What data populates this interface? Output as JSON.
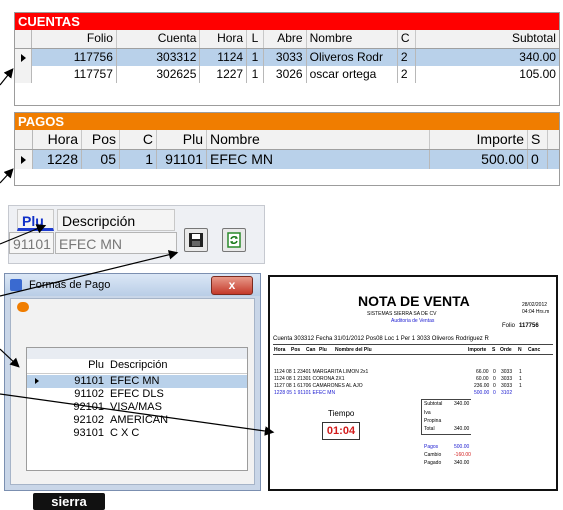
{
  "colors": {
    "cuentas_header": "#ff0000",
    "pagos_header": "#f07d00",
    "selection": "#b9d1ea",
    "timer_red": "#d21b1b"
  },
  "cuentas": {
    "title": "CUENTAS",
    "columns": [
      "Folio",
      "Cuenta",
      "Hora",
      "L",
      "Abre",
      "Nombre",
      "C",
      "Subtotal"
    ],
    "rows": [
      {
        "folio": "117756",
        "cuenta": "303312",
        "hora": "1124",
        "l": "1",
        "abre": "3033",
        "nombre": "Oliveros Rodr",
        "c": "2",
        "subtotal": "340.00"
      },
      {
        "folio": "117757",
        "cuenta": "302625",
        "hora": "1227",
        "l": "1",
        "abre": "3026",
        "nombre": "oscar ortega",
        "c": "2",
        "subtotal": "105.00"
      }
    ]
  },
  "pagos": {
    "title": "PAGOS",
    "columns": [
      "Hora",
      "Pos",
      "C",
      "Plu",
      "Nombre",
      "Importe",
      "S"
    ],
    "rows": [
      {
        "hora": "1228",
        "pos": "05",
        "c": "1",
        "plu": "91101",
        "nombre": "EFEC MN",
        "importe": "500.00",
        "s": "0"
      }
    ]
  },
  "producto": {
    "plu_label": "Plu",
    "desc_label": "Descripción",
    "plu_value": "91101",
    "desc_value": "EFEC MN",
    "save_icon": "floppy-disk-icon",
    "refresh_icon": "refresh-icon"
  },
  "formas_pago": {
    "title": "Formas de Pago",
    "close": "x",
    "columns": [
      "Plu",
      "Descripción"
    ],
    "rows": [
      {
        "plu": "91101",
        "desc": "EFEC MN"
      },
      {
        "plu": "91102",
        "desc": "EFEC DLS"
      },
      {
        "plu": "92101",
        "desc": "VISA/MAS"
      },
      {
        "plu": "92102",
        "desc": "AMERICAN"
      },
      {
        "plu": "93101",
        "desc": "C X C"
      }
    ],
    "logo": "sierra"
  },
  "receipt": {
    "title": "NOTA DE VENTA",
    "company": "SISTEMAS SIERRA SA DE CV",
    "auditoria": "Auditoria de Ventas",
    "date": "28/02/2012",
    "time": "04:04 Hrs.m",
    "folio_label": "Folio",
    "folio": "117756",
    "info_line": "Cuenta 303312  Fecha 31/01/2012  Pos08 Loc 1  Per 1   3033  Oliveros Rodriguez R",
    "columns": [
      "Hora",
      "Pos",
      "Can",
      "Plu",
      "Nombre del Plu",
      "Importe",
      "S",
      "Orde",
      "N",
      "Canc"
    ],
    "items": [
      {
        "text": "1124  08   1  23401  MARGARITA LIMON 2x1",
        "importe": "66.00",
        "s": "0",
        "orde": "3033",
        "n": "1"
      },
      {
        "text": "1124  08   1  21301  CORONA 2X1",
        "importe": "60.00",
        "s": "0",
        "orde": "3033",
        "n": "1"
      },
      {
        "text": "1127  08   1  61706  CAMARONES AL AJO",
        "importe": "236.00",
        "s": "0",
        "orde": "3033",
        "n": "1"
      },
      {
        "text": "1228  05   1  91101  EFEC MN",
        "importe": "500.00",
        "s": "0",
        "orde": "3102",
        "n": ""
      }
    ],
    "tiempo_label": "Tiempo",
    "tiempo": "01:04",
    "totals": [
      {
        "label": "Subtotal",
        "value": "340.00"
      },
      {
        "label": "Iva",
        "value": ""
      },
      {
        "label": "Propina",
        "value": ""
      },
      {
        "label": "Total",
        "value": "340.00"
      }
    ],
    "payments": [
      {
        "label": "Pagos",
        "value": "500.00"
      },
      {
        "label": "Cambio",
        "value": "-160.00"
      },
      {
        "label": "Pagado",
        "value": "340.00"
      }
    ]
  }
}
